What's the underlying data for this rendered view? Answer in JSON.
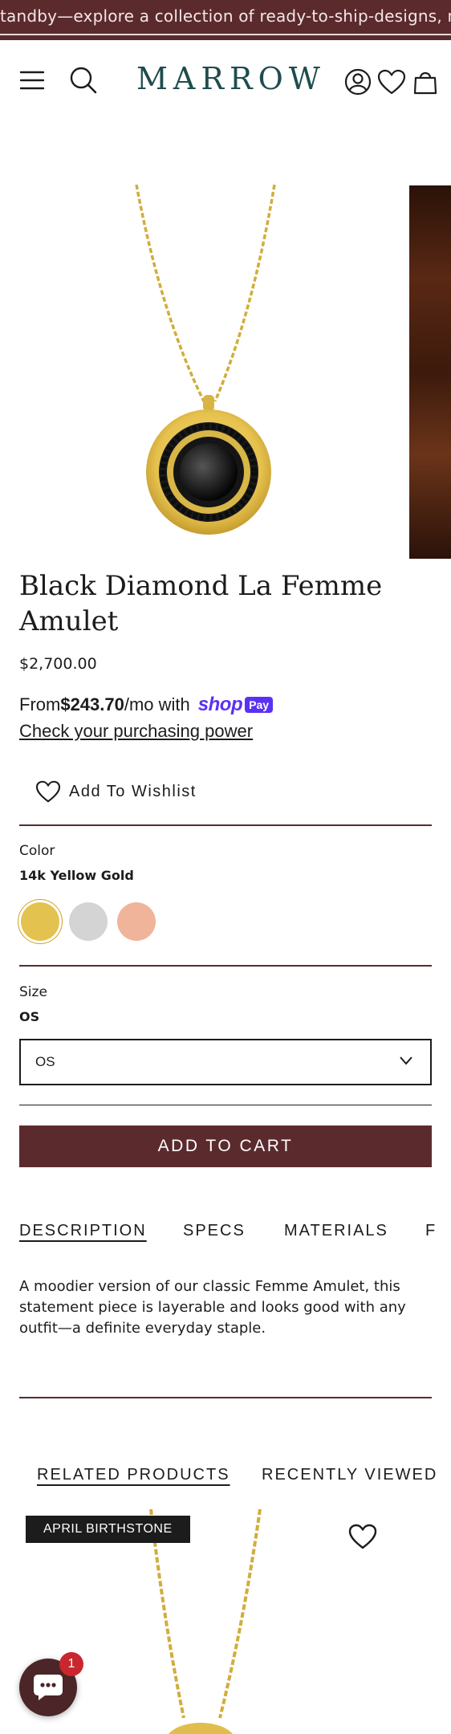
{
  "announcement": {
    "text": "tandby—explore a collection of ready-to-ship-designs, no waiting"
  },
  "header": {
    "logo": "MARROW",
    "icons": [
      "menu-icon",
      "search-icon",
      "account-icon",
      "heart-icon",
      "bag-icon"
    ]
  },
  "product": {
    "title_line1": "Black Diamond La Femme",
    "title_line2": "Amulet",
    "price": "$2,700.00",
    "installment_prefix": "From ",
    "installment_amount": "$243.70",
    "installment_suffix": "/mo with",
    "shop_word": "shop",
    "shop_pay": "Pay",
    "purchasing_link": "Check your purchasing power",
    "wishlist_label": "Add To Wishlist"
  },
  "options": {
    "color_label": "Color",
    "color_value": "14k Yellow Gold",
    "swatches": [
      {
        "name": "14k Yellow Gold",
        "color": "#e3c24f",
        "selected": true
      },
      {
        "name": "white",
        "color": "#d4d4d4",
        "selected": false
      },
      {
        "name": "rose",
        "color": "#f0b49a",
        "selected": false
      }
    ],
    "size_label": "Size",
    "size_value": "OS",
    "size_select": "OS"
  },
  "add_to_cart": "ADD TO CART",
  "tabs": [
    {
      "label": "DESCRIPTION",
      "active": true
    },
    {
      "label": "SPECS",
      "active": false
    },
    {
      "label": "MATERIALS",
      "active": false
    },
    {
      "label": "F",
      "active": false
    }
  ],
  "description": "A moodier version of our classic Femme Amulet, this statement piece is layerable and looks good with any outfit—a definite everyday staple.",
  "related": {
    "tabs": [
      {
        "label": "RELATED PRODUCTS",
        "active": true
      },
      {
        "label": "RECENTLY VIEWED",
        "active": false
      }
    ],
    "badge": "APRIL BIRTHSTONE"
  },
  "chat": {
    "unread": "1"
  },
  "colors": {
    "brand": "#5b2a2d",
    "logo": "#1f4c4e",
    "shop_pay": "#5a31f4"
  }
}
